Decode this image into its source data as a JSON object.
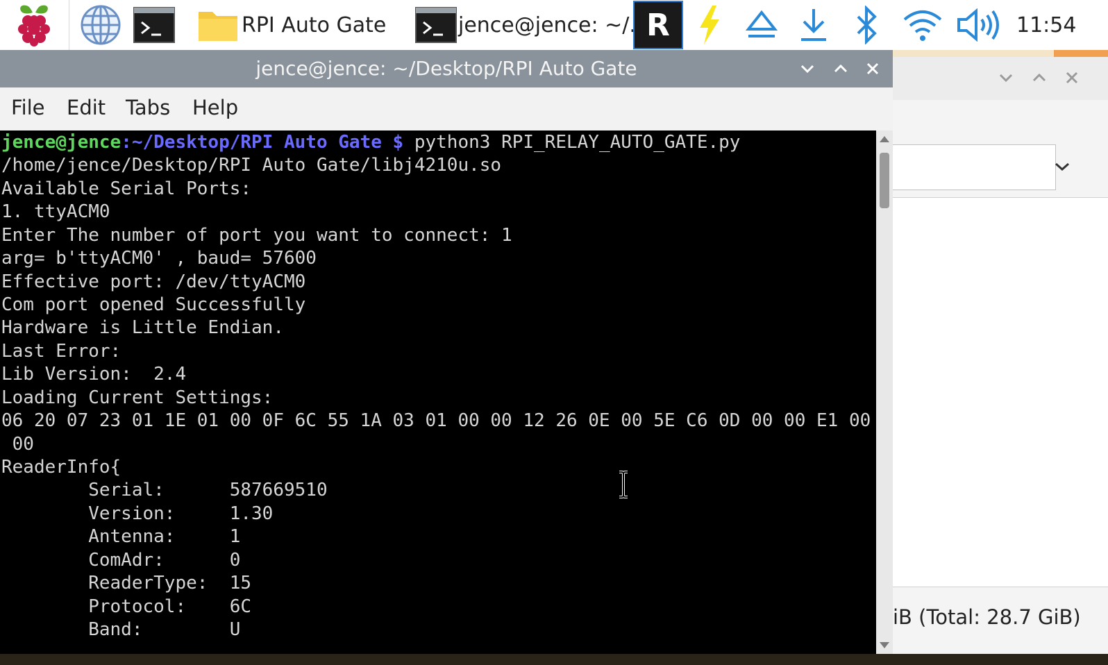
{
  "taskbar": {
    "app_tasks": [
      {
        "label": "RPI Auto Gate",
        "icon": "folder-icon"
      },
      {
        "label": "jence@jence: ~/...",
        "icon": "terminal-icon"
      }
    ],
    "tray": {
      "vnc_label": "R",
      "clock": "11:54"
    }
  },
  "terminal": {
    "title": "jence@jence: ~/Desktop/RPI Auto Gate",
    "menu": [
      "File",
      "Edit",
      "Tabs",
      "Help"
    ],
    "prompt": {
      "user": "jence@jence",
      "sep": ":",
      "path": "~/Desktop/RPI Auto Gate $",
      "command": " python3 RPI_RELAY_AUTO_GATE.py"
    },
    "lines": [
      "/home/jence/Desktop/RPI Auto Gate/libj4210u.so",
      "Available Serial Ports:",
      "1. ttyACM0",
      "Enter The number of port you want to connect: 1",
      "arg= b'ttyACM0' , baud= 57600",
      "Effective port: /dev/ttyACM0",
      "Com port opened Successfully",
      "Hardware is Little Endian.",
      "Last Error:",
      "Lib Version:  2.4",
      "Loading Current Settings:",
      "06 20 07 23 01 1E 01 00 0F 6C 55 1A 03 01 00 00 12 26 0E 00 5E C6 0D 00 00 E1 00",
      " 00",
      "ReaderInfo{",
      "        Serial:      587669510",
      "        Version:     1.30",
      "        Antenna:     1",
      "        ComAdr:      0",
      "        ReaderType:  15",
      "        Protocol:    6C",
      "        Band:        U"
    ]
  },
  "background_window": {
    "status_text": "iB (Total: 28.7 GiB)"
  },
  "colors": {
    "titlebar": "#8a939b",
    "prompt_user": "#5fd75f",
    "prompt_path": "#6a6aff",
    "terminal_bg": "#000000",
    "terminal_text": "#d6d6d6"
  }
}
